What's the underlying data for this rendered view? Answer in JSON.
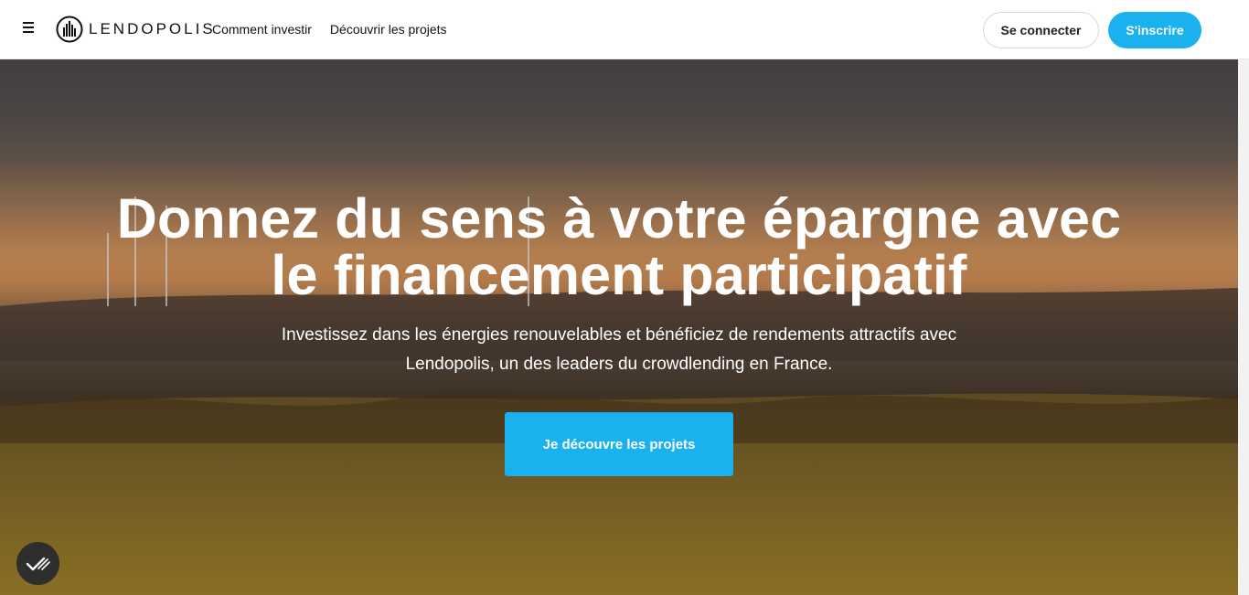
{
  "header": {
    "menu_icon": "hamburger-icon",
    "logo_text": "LENDOPOLIS",
    "nav": [
      {
        "label": "Comment investir"
      },
      {
        "label": "Découvrir les projets"
      }
    ],
    "login_label": "Se connecter",
    "signup_label": "S'inscrire"
  },
  "hero": {
    "title_line1": "Donnez du sens à votre épargne avec",
    "title_line2": "le financement participatif",
    "subtitle_line1": "Investissez dans les énergies renouvelables et bénéficiez de rendements attractifs avec",
    "subtitle_line2": "Lendopolis, un des leaders du crowdlending en France.",
    "cta_label": "Je découvre les projets",
    "cookie_icon": "cookie-consent-icon"
  },
  "colors": {
    "accent": "#1ab1ef",
    "text_dark": "#111111",
    "badge_bg": "#2e2e2e"
  }
}
